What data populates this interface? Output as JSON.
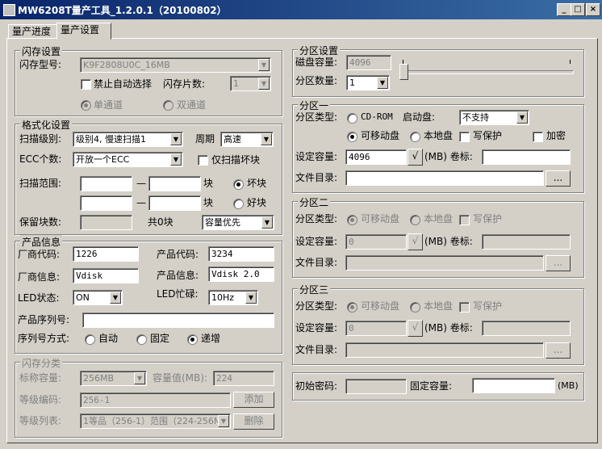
{
  "window": {
    "title": "MW6208T量产工具_1.2.0.1（20100802）",
    "min": "_",
    "max": "□",
    "close": "×"
  },
  "tabs": [
    {
      "label": "量产进度"
    },
    {
      "label": "量产设置"
    }
  ],
  "flash": {
    "group": "闪存设置",
    "type_label": "闪存型号:",
    "type_value": "K9F2808U0C_16MB",
    "disable_auto": "禁止自动选择",
    "chips_label": "闪存片数:",
    "chips_value": "1",
    "single": "单通道",
    "dual": "双通道"
  },
  "format": {
    "group": "格式化设置",
    "scan_label": "扫描级别:",
    "scan_value": "级别4, 慢速扫描1",
    "cycle_label": "周期",
    "cycle_value": "高速",
    "ecc_label": "ECC个数:",
    "ecc_value": "开放一个ECC",
    "bad_only": "仅扫描坏块",
    "range_label": "扫描范围:",
    "dash": "—",
    "block": "块",
    "bad": "坏块",
    "good": "好块",
    "reserve_label": "保留块数:",
    "total": "共0块",
    "mode_value": "容量优先"
  },
  "product": {
    "group": "产品信息",
    "vendor_code_label": "厂商代码:",
    "vendor_code": "1226",
    "product_code_label": "产品代码:",
    "product_code": "3234",
    "vendor_info_label": "厂商信息:",
    "vendor_info": "Vdisk",
    "product_info_label": "产品信息:",
    "product_info": "Vdisk 2.0",
    "led_label": "LED状态:",
    "led_value": "ON",
    "led_busy_label": "LED忙碌:",
    "led_busy_value": "10Hz",
    "serial_label": "产品序列号:",
    "serial_value": "",
    "serial_mode_label": "序列号方式:",
    "auto": "自动",
    "fixed": "固定",
    "inc": "递增"
  },
  "flash_class": {
    "group": "闪存分类",
    "nominal_label": "标称容量:",
    "nominal_value": "256MB",
    "cap_label": "容量值(MB):",
    "cap_value": "224",
    "grade_code_label": "等级编码:",
    "grade_code": "256-1",
    "add": "添加",
    "grade_list_label": "等级列表:",
    "grade_list_value": "1等品（256-1）范围（224-256M",
    "delete": "删除"
  },
  "partition": {
    "group": "分区设置",
    "disk_cap_label": "磁盘容量:",
    "disk_cap": "4096",
    "count_label": "分区数量:",
    "count_value": "1",
    "slider_value": 0
  },
  "p1": {
    "group": "分区一",
    "type_label": "分区类型:",
    "cdrom": "CD-ROM",
    "boot_label": "启动盘:",
    "boot_value": "不支持",
    "removable": "可移动盘",
    "local": "本地盘",
    "wp": "写保护",
    "enc": "加密",
    "cap_label": "设定容量:",
    "cap_value": "4096",
    "mb_vol": "(MB) 卷标:",
    "vol": "",
    "dir_label": "文件目录:",
    "dir": "",
    "browse": "...",
    "check": "√"
  },
  "p2": {
    "group": "分区二",
    "type_label": "分区类型:",
    "removable": "可移动盘",
    "local": "本地盘",
    "wp": "写保护",
    "cap_label": "设定容量:",
    "cap_value": "0",
    "mb_vol": "(MB) 卷标:",
    "dir_label": "文件目录:",
    "browse": "...",
    "check": "√"
  },
  "p3": {
    "group": "分区三",
    "type_label": "分区类型:",
    "removable": "可移动盘",
    "local": "本地盘",
    "wp": "写保护",
    "cap_label": "设定容量:",
    "cap_value": "0",
    "mb_vol": "(MB) 卷标:",
    "dir_label": "文件目录:",
    "browse": "...",
    "check": "√"
  },
  "bottom": {
    "pwd_label": "初始密码:",
    "fixed_cap_label": "固定容量:",
    "mb": "(MB)"
  }
}
